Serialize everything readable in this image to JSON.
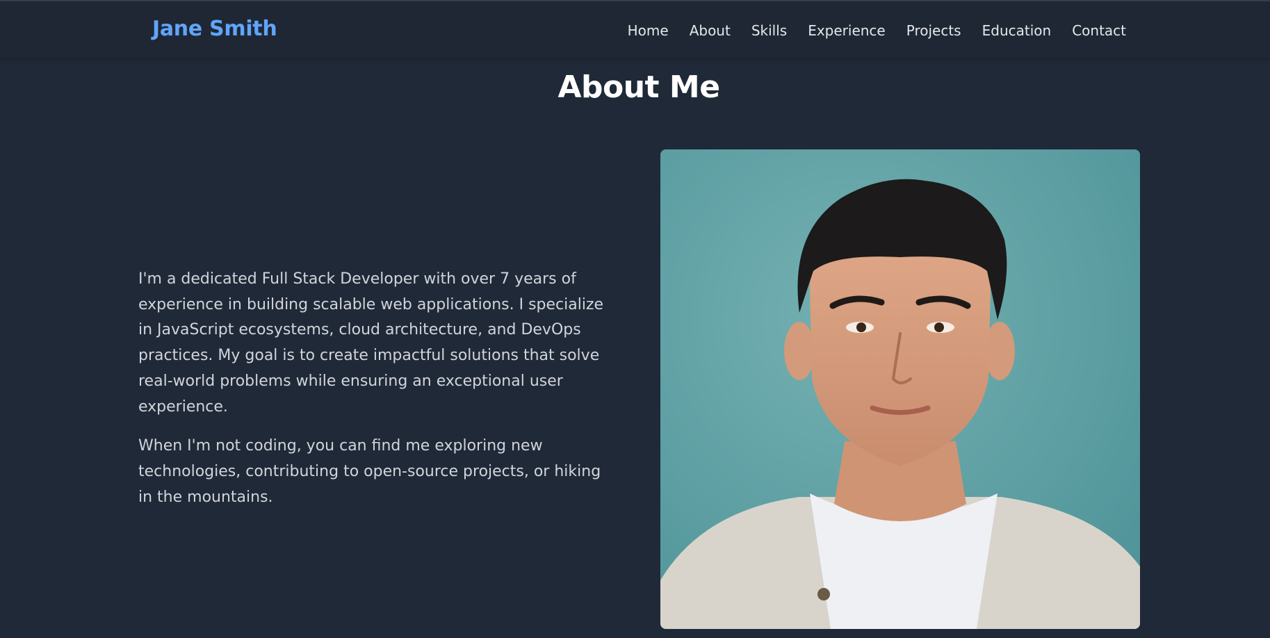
{
  "nav": {
    "brand": "Jane Smith",
    "links": [
      "Home",
      "About",
      "Skills",
      "Experience",
      "Projects",
      "Education",
      "Contact"
    ]
  },
  "about": {
    "title": "About Me",
    "paragraphs": [
      "I'm a dedicated Full Stack Developer with over 7 years of experience in building scalable web applications. I specialize in JavaScript ecosystems, cloud architecture, and DevOps practices. My goal is to create impactful solutions that solve real-world problems while ensuring an exceptional user experience.",
      "When I'm not coding, you can find me exploring new technologies, contributing to open-source projects, or hiking in the mountains."
    ]
  },
  "colors": {
    "background": "#202938",
    "brand": "#60a5fa",
    "text": "#d1d5db",
    "heading": "#ffffff"
  }
}
